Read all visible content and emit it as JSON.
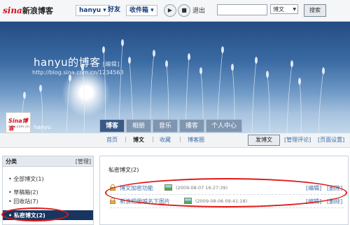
{
  "topbar": {
    "logo_sina": "sina",
    "logo_text": "新浪博客",
    "user_menu": "hanyu ▾",
    "friends": "好友",
    "favorites_menu": "收件箱 ▾",
    "play_icon": "▶",
    "stop_icon": "■",
    "logout": "退出",
    "search_placeholder": "",
    "search_type": "博文",
    "search_button": "搜索"
  },
  "banner": {
    "blog_title": "hanyu的博客",
    "edit_label": "[编辑]",
    "blog_url": "http://blog.sina.com.cn/1234​5​6​3"
  },
  "profile": {
    "avatar_line1": "Sina博客",
    "avatar_line2": "sina.com.cn",
    "username": "hanyu"
  },
  "tabs": [
    "博客",
    "相册",
    "音乐",
    "播客",
    "个人中心"
  ],
  "subnav": {
    "items": [
      "首页",
      "博文",
      "收藏",
      "博客圈"
    ],
    "publish_button": "发博文",
    "manage_comments": "[管理评论]",
    "page_settings": "[页面设置]"
  },
  "sidebar": {
    "title": "分类",
    "manage": "[管理]",
    "items": [
      "全部博文(1)",
      "草稿箱(2)",
      "回收站(7)",
      "私密博文(2)"
    ]
  },
  "main": {
    "title": "私密博文(2)",
    "posts": [
      {
        "title": "博文加密功能",
        "date": "(2009-08-07 16:27:39)",
        "edit": "[编辑]",
        "delete": "[删除]"
      },
      {
        "title": "新浪相册喊名下图片",
        "date": "(2009-08-06 09:41:18)",
        "edit": "[编辑]",
        "delete": "[删除]"
      }
    ]
  },
  "colors": {
    "annotation_red": "#e01818",
    "nav_active": "#17355f",
    "link_blue": "#3f6fa8"
  }
}
